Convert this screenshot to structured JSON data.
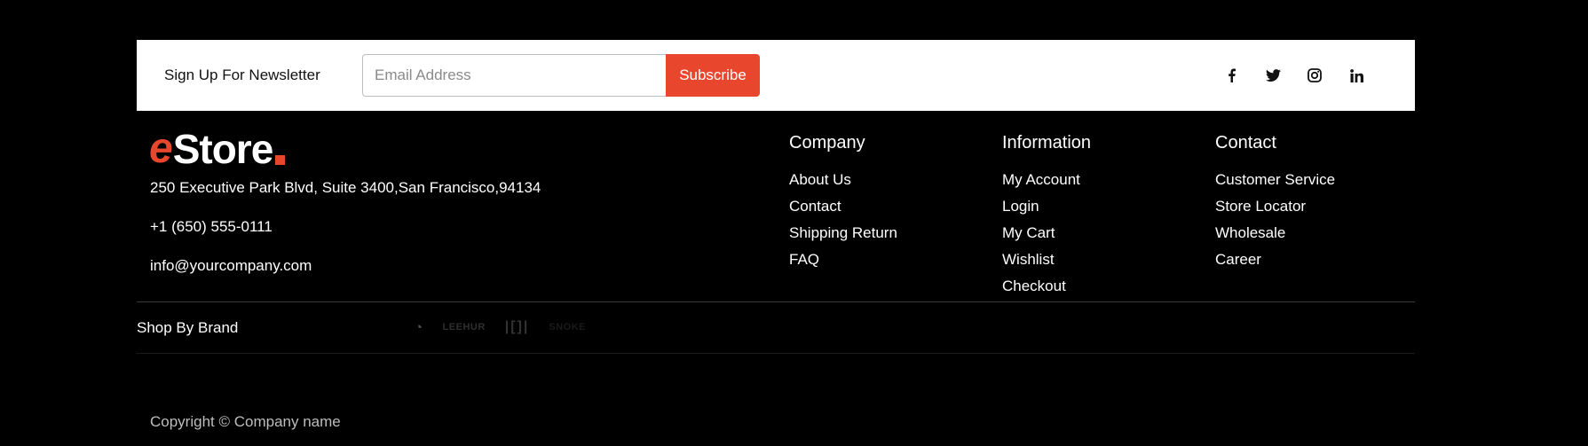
{
  "newsletter": {
    "label": "Sign Up For Newsletter",
    "email_placeholder": "Email Address",
    "subscribe_label": "Subscribe"
  },
  "social": [
    "facebook-icon",
    "twitter-icon",
    "instagram-icon",
    "linkedin-icon"
  ],
  "brand": {
    "logo_initial": "e",
    "logo_text": "Store",
    "accent_color": "#e8472e"
  },
  "address": {
    "street": "250 Executive Park Blvd, Suite 3400,San Francisco,94134",
    "phone": "+1 (650) 555-0111",
    "email": "info@yourcompany.com"
  },
  "columns": {
    "company": {
      "title": "Company",
      "links": [
        "About Us",
        "Contact",
        "Shipping Return",
        "FAQ"
      ]
    },
    "information": {
      "title": "Information",
      "links": [
        "My Account",
        "Login",
        "My Cart",
        "Wishlist",
        "Checkout"
      ]
    },
    "contact": {
      "title": "Contact",
      "links": [
        "Customer Service",
        "Store Locator",
        "Wholesale",
        "Career"
      ]
    }
  },
  "shop_by_brand": {
    "label": "Shop By Brand",
    "logos": [
      "◔",
      "LEEHUR",
      "|[]|",
      "SNOKE"
    ]
  },
  "copyright": "Copyright © Company name"
}
